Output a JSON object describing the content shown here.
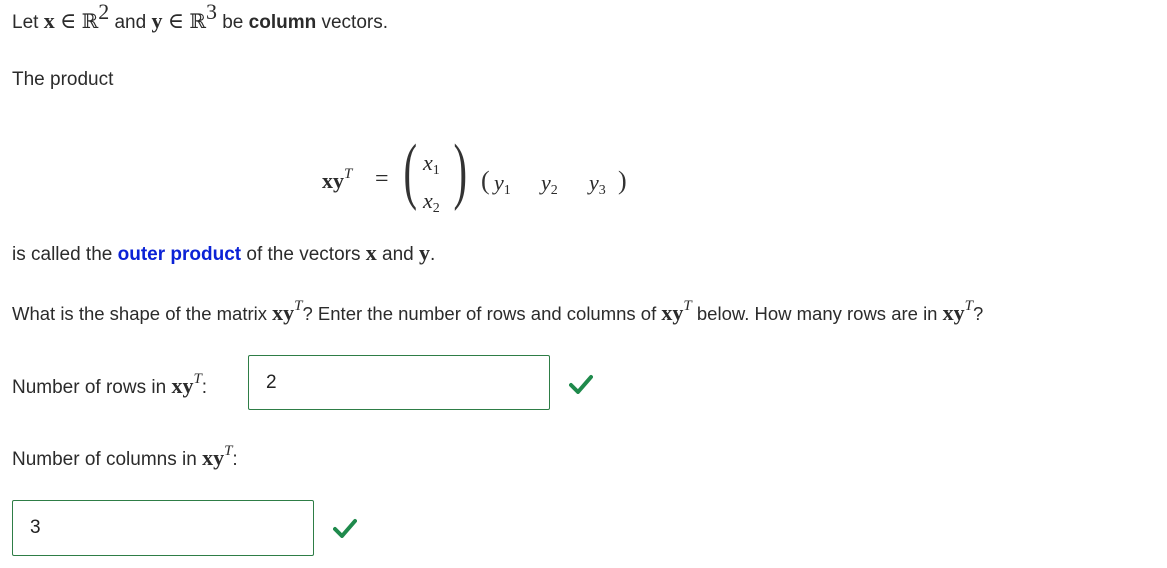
{
  "intro": {
    "prefix": "Let",
    "x": "x",
    "in1": "∈",
    "r1": "ℝ",
    "r1_exp": "2",
    "and": "and",
    "y": "y",
    "in2": "∈",
    "r2": "ℝ",
    "r2_exp": "3",
    "be": "be",
    "column": "column",
    "vectors": "vectors."
  },
  "product_label": "The product",
  "equation": {
    "lhs_vec": "xy",
    "lhs_exp": "T",
    "equals": "=",
    "x1": "x",
    "x1_sub": "1",
    "x2": "x",
    "x2_sub": "2",
    "y1": "y",
    "y1_sub": "1",
    "y2": "y",
    "y2_sub": "2",
    "y3": "y",
    "y3_sub": "3"
  },
  "called": {
    "prefix": "is called the",
    "term": "outer product",
    "suffix": "of the vectors",
    "x": "x",
    "and": "and",
    "y": "y",
    "end": "."
  },
  "question": {
    "part1": "What is the shape of the matrix",
    "vec1": "xy",
    "exp1": "T",
    "part2": "? Enter the number of rows and columns of",
    "vec2": "xy",
    "exp2": "T",
    "part3": "below. How many rows are in",
    "vec3": "xy",
    "exp3": "T",
    "part4": "?"
  },
  "rows_field": {
    "label": "Number of rows in",
    "vec": "xy",
    "exp": "T",
    "colon": ":",
    "value": "2",
    "status": "correct"
  },
  "cols_field": {
    "label": "Number of columns in",
    "vec": "xy",
    "exp": "T",
    "colon": ":",
    "value": "3",
    "status": "correct"
  },
  "colors": {
    "accent_blue": "#0b22d6",
    "correct_green": "#2e7d46",
    "check_green": "#1f8a4c"
  },
  "icons": {
    "correct": "checkmark-icon"
  }
}
